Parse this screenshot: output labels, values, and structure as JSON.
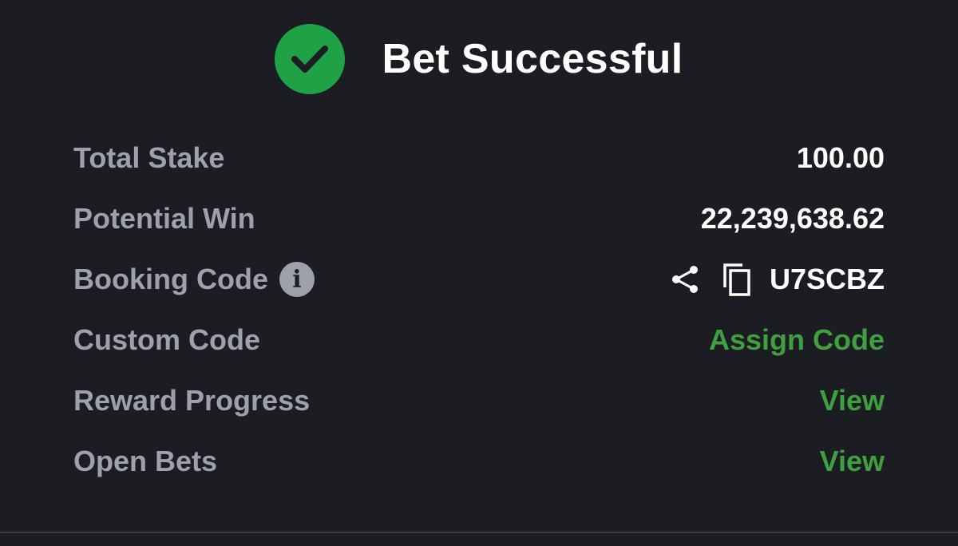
{
  "header": {
    "title": "Bet Successful",
    "icon": "check-circle-icon",
    "icon_color": "#1fa246"
  },
  "details": {
    "total_stake": {
      "label": "Total Stake",
      "value": "100.00"
    },
    "potential_win": {
      "label": "Potential Win",
      "value": "22,239,638.62"
    },
    "booking_code": {
      "label": "Booking Code",
      "value": "U7SCBZ",
      "info_glyph": "i"
    },
    "custom_code": {
      "label": "Custom Code",
      "action": "Assign Code"
    },
    "reward_progress": {
      "label": "Reward Progress",
      "action": "View"
    },
    "open_bets": {
      "label": "Open Bets",
      "action": "View"
    }
  },
  "colors": {
    "background": "#1c1d22",
    "label": "#9ea1aa",
    "value": "#ffffff",
    "action": "#3fa03f"
  }
}
